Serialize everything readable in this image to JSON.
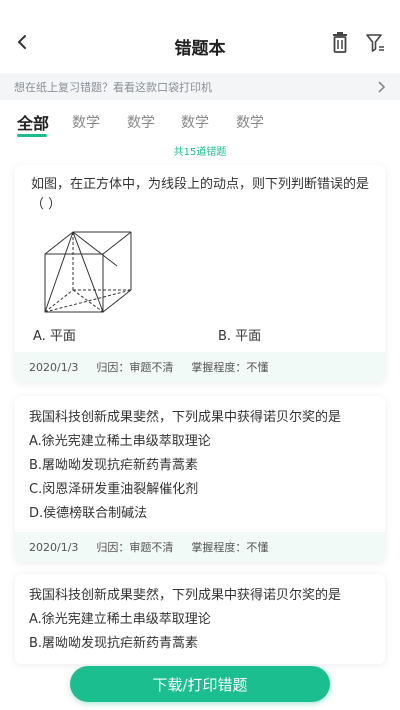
{
  "header": {
    "title": "错题本",
    "back_icon": "back-arrow-icon",
    "trash_icon": "trash-icon",
    "filter_icon": "filter-icon"
  },
  "banner": {
    "text": "想在纸上复习错题？看看这款口袋打印机"
  },
  "tabs": [
    {
      "label": "全部",
      "active": true
    },
    {
      "label": "数学",
      "active": false
    },
    {
      "label": "数学",
      "active": false
    },
    {
      "label": "数学",
      "active": false
    },
    {
      "label": "数学",
      "active": false
    }
  ],
  "count_text": "共15道错题",
  "cards": [
    {
      "question": "如图，在正方体中，为线段上的动点，则下列判断错误的是（ ）",
      "option_a": "A. 平面",
      "option_b": "B. 平面",
      "date": "2020/1/3",
      "cause": "归因：审题不清",
      "mastery": "掌握程度：不懂"
    },
    {
      "lines": [
        "我国科技创新成果斐然，下列成果中获得诺贝尔奖的是",
        "A.徐光宪建立稀土串级萃取理论",
        "B.屠呦呦发现抗疟新药青蒿素",
        "C.闵恩泽研发重油裂解催化剂",
        "D.侯德榜联合制碱法"
      ],
      "date": "2020/1/3",
      "cause": "归因：审题不清",
      "mastery": "掌握程度：不懂"
    },
    {
      "lines": [
        "我国科技创新成果斐然，下列成果中获得诺贝尔奖的是",
        "A.徐光宪建立稀土串级萃取理论",
        "B.屠呦呦发现抗疟新药青蒿素"
      ]
    }
  ],
  "print_button": "下载/打印错题",
  "colors": {
    "accent": "#1bbf8f",
    "meta_bg": "#f1faf7",
    "banner_bg": "#f4f5f7"
  }
}
